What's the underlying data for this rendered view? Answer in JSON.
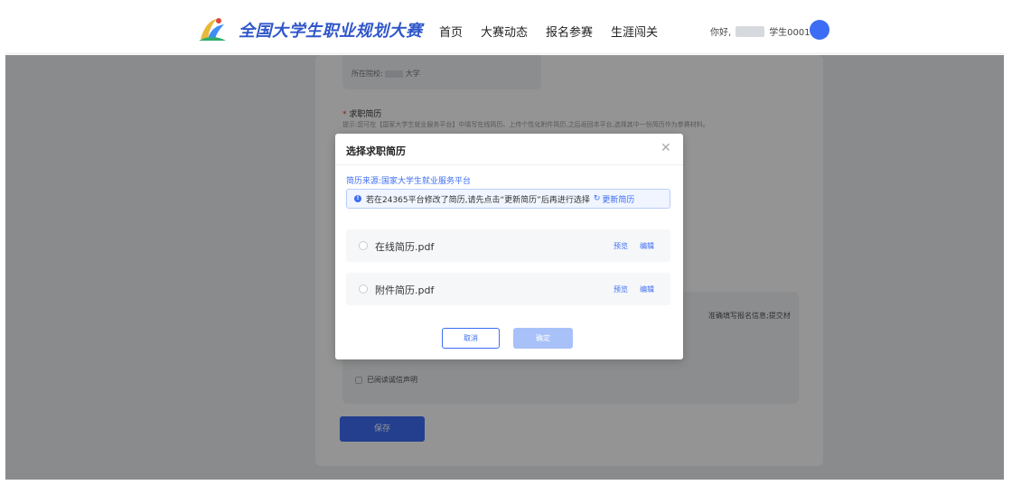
{
  "header": {
    "brand": "全国大学生职业规划大赛",
    "nav": [
      "首页",
      "大赛动态",
      "报名参赛",
      "生涯闯关"
    ],
    "greeting": "你好,",
    "username": "学生0001"
  },
  "form": {
    "school_label": "所在院校:",
    "school_suffix": "大学",
    "resume_title": "求职简历",
    "resume_required_mark": "*",
    "resume_tip": "提示:您可在【国家大学生就业服务平台】中填写在线简历、上传个性化附件简历,之后返回本平台,选择其中一份简历作为参赛材料。",
    "info_text": "准确填写报名信息;提交材",
    "read_statement": "已阅读诚信声明",
    "save_label": "保存"
  },
  "modal": {
    "title": "选择求职简历",
    "source": "简历来源:国家大学生就业服务平台",
    "notice": "若在24365平台修改了简历,请先点击“更新简历”后再进行选择",
    "update_link": "更新简历",
    "items": [
      {
        "name": "在线简历.pdf",
        "preview": "预览",
        "edit": "编辑"
      },
      {
        "name": "附件简历.pdf",
        "preview": "预览",
        "edit": "编辑"
      }
    ],
    "cancel_label": "取消",
    "confirm_label": "确定"
  },
  "colors": {
    "accent": "#3d6df5",
    "brand": "#2f56c9",
    "confirm_disabled": "#a8c1f8"
  }
}
